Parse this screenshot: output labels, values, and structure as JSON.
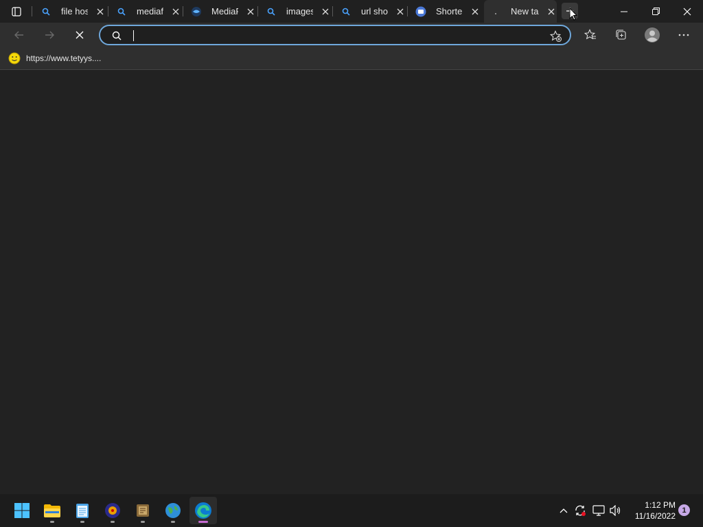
{
  "tabs": [
    {
      "title": "file host",
      "icon": "search-icon"
    },
    {
      "title": "mediafire",
      "icon": "search-icon"
    },
    {
      "title": "MediaFire",
      "icon": "mediafire-icon"
    },
    {
      "title": "imageshack",
      "icon": "search-icon"
    },
    {
      "title": "url shortener",
      "icon": "search-icon"
    },
    {
      "title": "Shorten",
      "icon": "shortener-icon"
    },
    {
      "title": "New tab",
      "icon": "loading-icon"
    }
  ],
  "address_bar": {
    "value": "",
    "placeholder": ""
  },
  "favorites": [
    {
      "label": "https://www.tetyys...."
    }
  ],
  "clock": {
    "time": "1:12 PM",
    "date": "11/16/2022"
  },
  "notifications": {
    "count": "1"
  },
  "colors": {
    "accent": "#6fa8dc",
    "bg": "#202020",
    "toolbar": "#2f2f2f"
  }
}
